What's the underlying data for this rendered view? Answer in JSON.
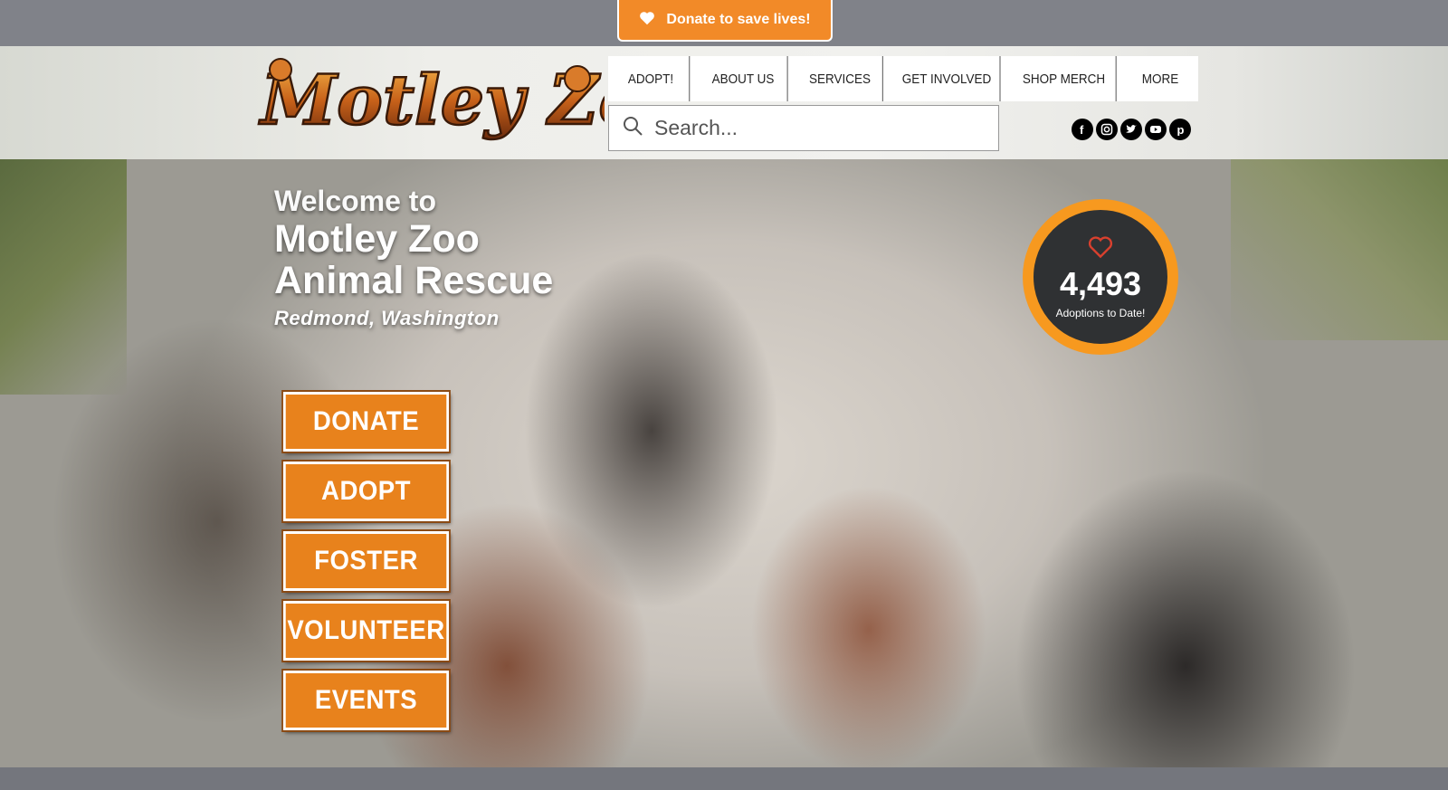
{
  "donate_tab": {
    "label": "Donate to save lives!"
  },
  "logo": {
    "alt": "Motley Zoo"
  },
  "nav": {
    "items": [
      {
        "label": "ADOPT!"
      },
      {
        "label": "ABOUT US"
      },
      {
        "label": "SERVICES"
      },
      {
        "label": "GET INVOLVED"
      },
      {
        "label": "SHOP MERCH"
      },
      {
        "label": "MORE"
      }
    ]
  },
  "search": {
    "placeholder": "Search..."
  },
  "social": {
    "items": [
      {
        "icon": "facebook-icon",
        "glyph": "f"
      },
      {
        "icon": "instagram-icon",
        "glyph": "◎"
      },
      {
        "icon": "twitter-icon",
        "glyph": "t"
      },
      {
        "icon": "youtube-icon",
        "glyph": "▶"
      },
      {
        "icon": "pinterest-icon",
        "glyph": "p"
      }
    ]
  },
  "hero": {
    "welcome": "Welcome to",
    "title_line1": "Motley Zoo",
    "title_line2": "Animal Rescue",
    "location": "Redmond, Washington"
  },
  "actions": {
    "donate": "DONATE",
    "adopt": "ADOPT",
    "foster": "FOSTER",
    "volunteer": "VOLUNTEER",
    "events": "EVENTS"
  },
  "counter": {
    "value": "4,493",
    "label": "Adoptions to Date!"
  },
  "colors": {
    "accent": "#f28a28",
    "button": "#e8821c",
    "ring": "#f7991f",
    "counter_bg": "#2f3133"
  }
}
